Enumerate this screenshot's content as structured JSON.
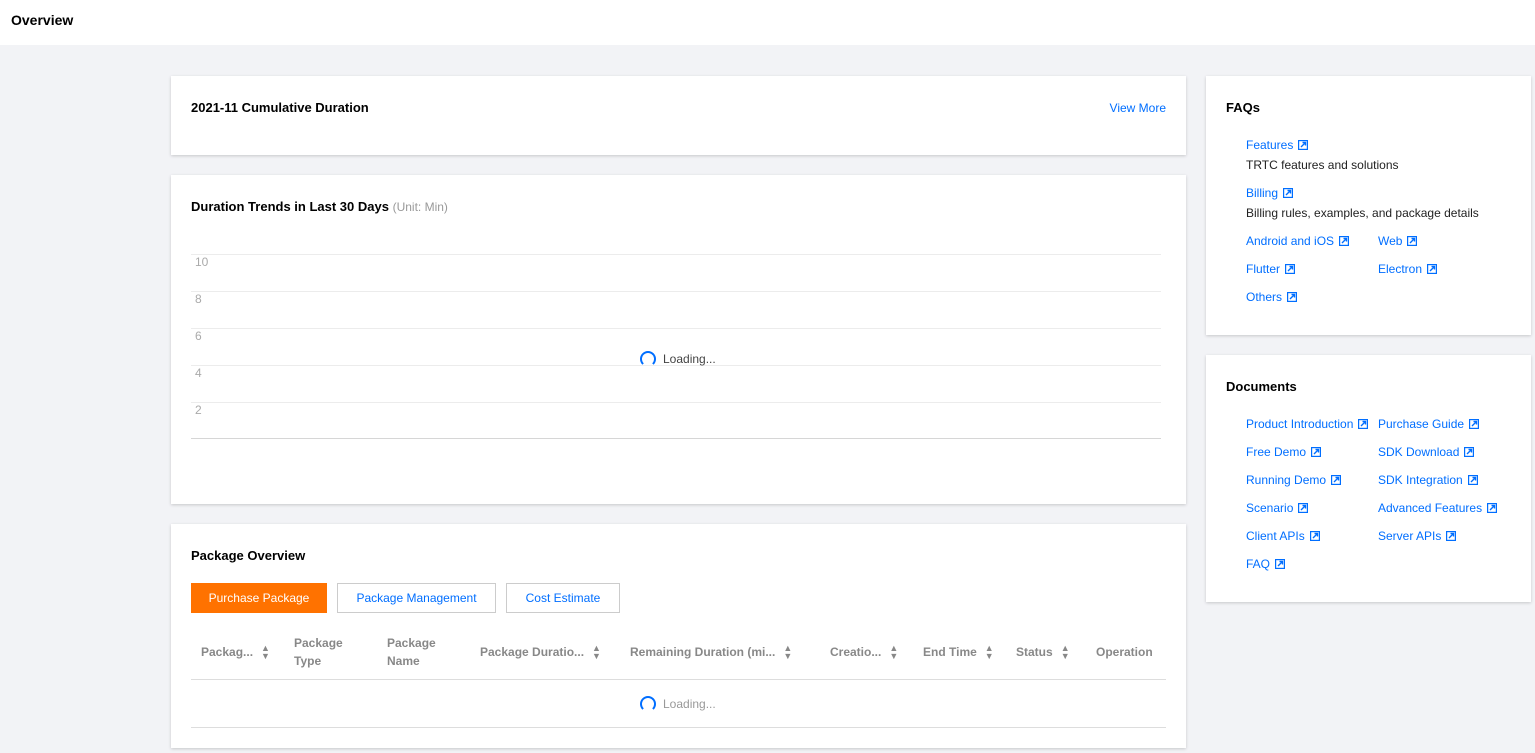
{
  "header": {
    "title": "Overview"
  },
  "cumulative": {
    "title": "2021-11 Cumulative Duration",
    "view_more": "View More"
  },
  "trends": {
    "title": "Duration Trends in Last 30 Days",
    "unit": "(Unit: Min)",
    "loading": "Loading...",
    "y_ticks": [
      "10",
      "8",
      "6",
      "4",
      "2"
    ]
  },
  "chart_data": {
    "type": "line",
    "title": "Duration Trends in Last 30 Days",
    "ylabel": "(Unit: Min)",
    "y_ticks": [
      10,
      8,
      6,
      4,
      2
    ],
    "ylim": [
      0,
      10
    ],
    "grid": true,
    "series": []
  },
  "package": {
    "title": "Package Overview",
    "buttons": {
      "purchase": "Purchase Package",
      "management": "Package Management",
      "estimate": "Cost Estimate"
    },
    "columns": [
      {
        "label": "Packag...",
        "sortable": true
      },
      {
        "label": "Package Type",
        "sortable": false
      },
      {
        "label": "Package Name",
        "sortable": false
      },
      {
        "label": "Package Duratio...",
        "sortable": true
      },
      {
        "label": "Remaining Duration (mi...",
        "sortable": true
      },
      {
        "label": "Creatio...",
        "sortable": true
      },
      {
        "label": "End Time",
        "sortable": true
      },
      {
        "label": "Status",
        "sortable": true
      },
      {
        "label": "Operation",
        "sortable": false
      }
    ],
    "loading": "Loading..."
  },
  "faqs": {
    "title": "FAQs",
    "features": "Features",
    "features_desc": "TRTC features and solutions",
    "billing": "Billing",
    "billing_desc": "Billing rules, examples, and package details",
    "android_ios": "Android and iOS",
    "web": "Web",
    "flutter": "Flutter",
    "electron": "Electron",
    "others": "Others"
  },
  "documents": {
    "title": "Documents",
    "left": [
      "Product Introduction",
      "Free Demo",
      "Running Demo",
      "Scenario",
      "Client APIs",
      "FAQ"
    ],
    "right": [
      "Purchase Guide",
      "SDK Download",
      "SDK Integration",
      "Advanced Features",
      "Server APIs"
    ]
  },
  "colors": {
    "accent": "#006eff",
    "primary_button": "#ff7200",
    "background": "#f2f3f6"
  }
}
